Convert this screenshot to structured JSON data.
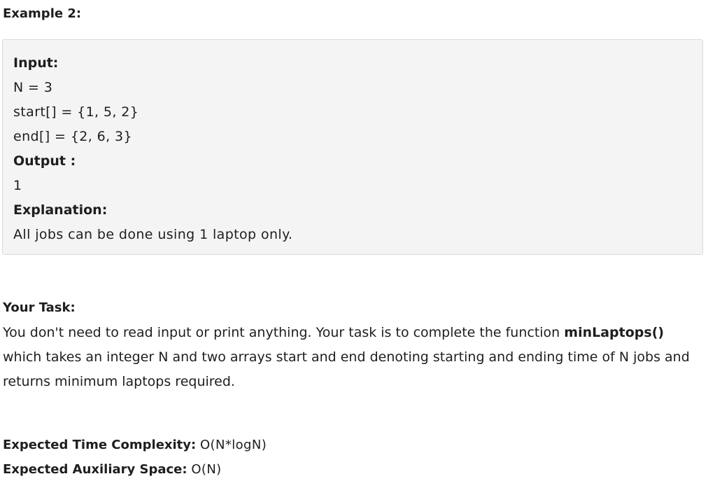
{
  "example": {
    "heading": "Example 2:",
    "input_label": "Input:",
    "lines": [
      "N = 3",
      "start[] = {1, 5, 2}",
      "end[] = {2, 6, 3}"
    ],
    "output_label": "Output :",
    "output_value": "1",
    "explanation_label": "Explanation:",
    "explanation_text": "All jobs can be done using 1 laptop only."
  },
  "task": {
    "heading": "Your Task:",
    "text_before": "You don't need to read input or print anything. Your task is to complete the function ",
    "function_name": "minLaptops()",
    "text_after": " which takes an integer N and two arrays start and end denoting starting and ending time of N jobs and returns minimum laptops required."
  },
  "complexity": {
    "time_label": "Expected Time Complexity:",
    "time_value": "O(N*logN)",
    "space_label": "Expected Auxiliary Space:",
    "space_value": "O(N)"
  }
}
